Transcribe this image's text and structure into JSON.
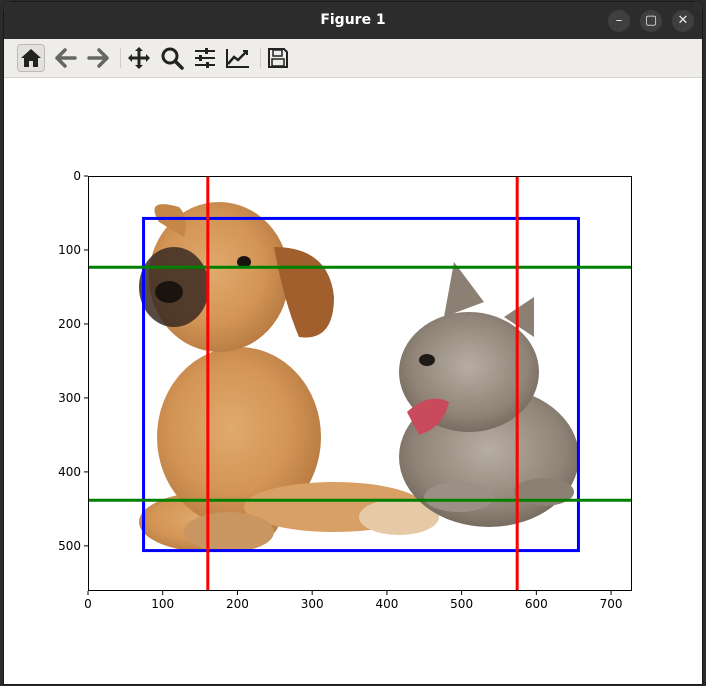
{
  "window": {
    "title": "Figure 1",
    "minimize_glyph": "–",
    "maximize_glyph": "▢",
    "close_glyph": "✕"
  },
  "toolbar": {
    "buttons": [
      {
        "name": "home-icon",
        "active": true
      },
      {
        "name": "back-arrow-icon"
      },
      {
        "name": "forward-arrow-icon"
      },
      {
        "name": "pan-icon"
      },
      {
        "name": "zoom-icon"
      },
      {
        "name": "configure-subplots-icon"
      },
      {
        "name": "edit-axes-icon"
      },
      {
        "name": "save-icon"
      }
    ]
  },
  "chart_data": {
    "type": "image-with-overlays",
    "xlim": [
      0,
      728
    ],
    "ylim": [
      561,
      0
    ],
    "xticks": [
      "0",
      "100",
      "200",
      "300",
      "400",
      "500",
      "600",
      "700"
    ],
    "xtick_values": [
      0,
      100,
      200,
      300,
      400,
      500,
      600,
      700
    ],
    "yticks": [
      "0",
      "100",
      "200",
      "300",
      "400",
      "500"
    ],
    "ytick_values": [
      0,
      100,
      200,
      300,
      400,
      500
    ],
    "rectangle": {
      "x0": 73,
      "y0": 56,
      "x1": 655,
      "y1": 505,
      "color": "#0000ff"
    },
    "vertical_lines": [
      {
        "x": 159,
        "color": "#ff0000"
      },
      {
        "x": 573,
        "color": "#ff0000"
      }
    ],
    "horizontal_lines": [
      {
        "y": 122,
        "color": "#008000"
      },
      {
        "y": 437,
        "color": "#008000"
      }
    ]
  }
}
